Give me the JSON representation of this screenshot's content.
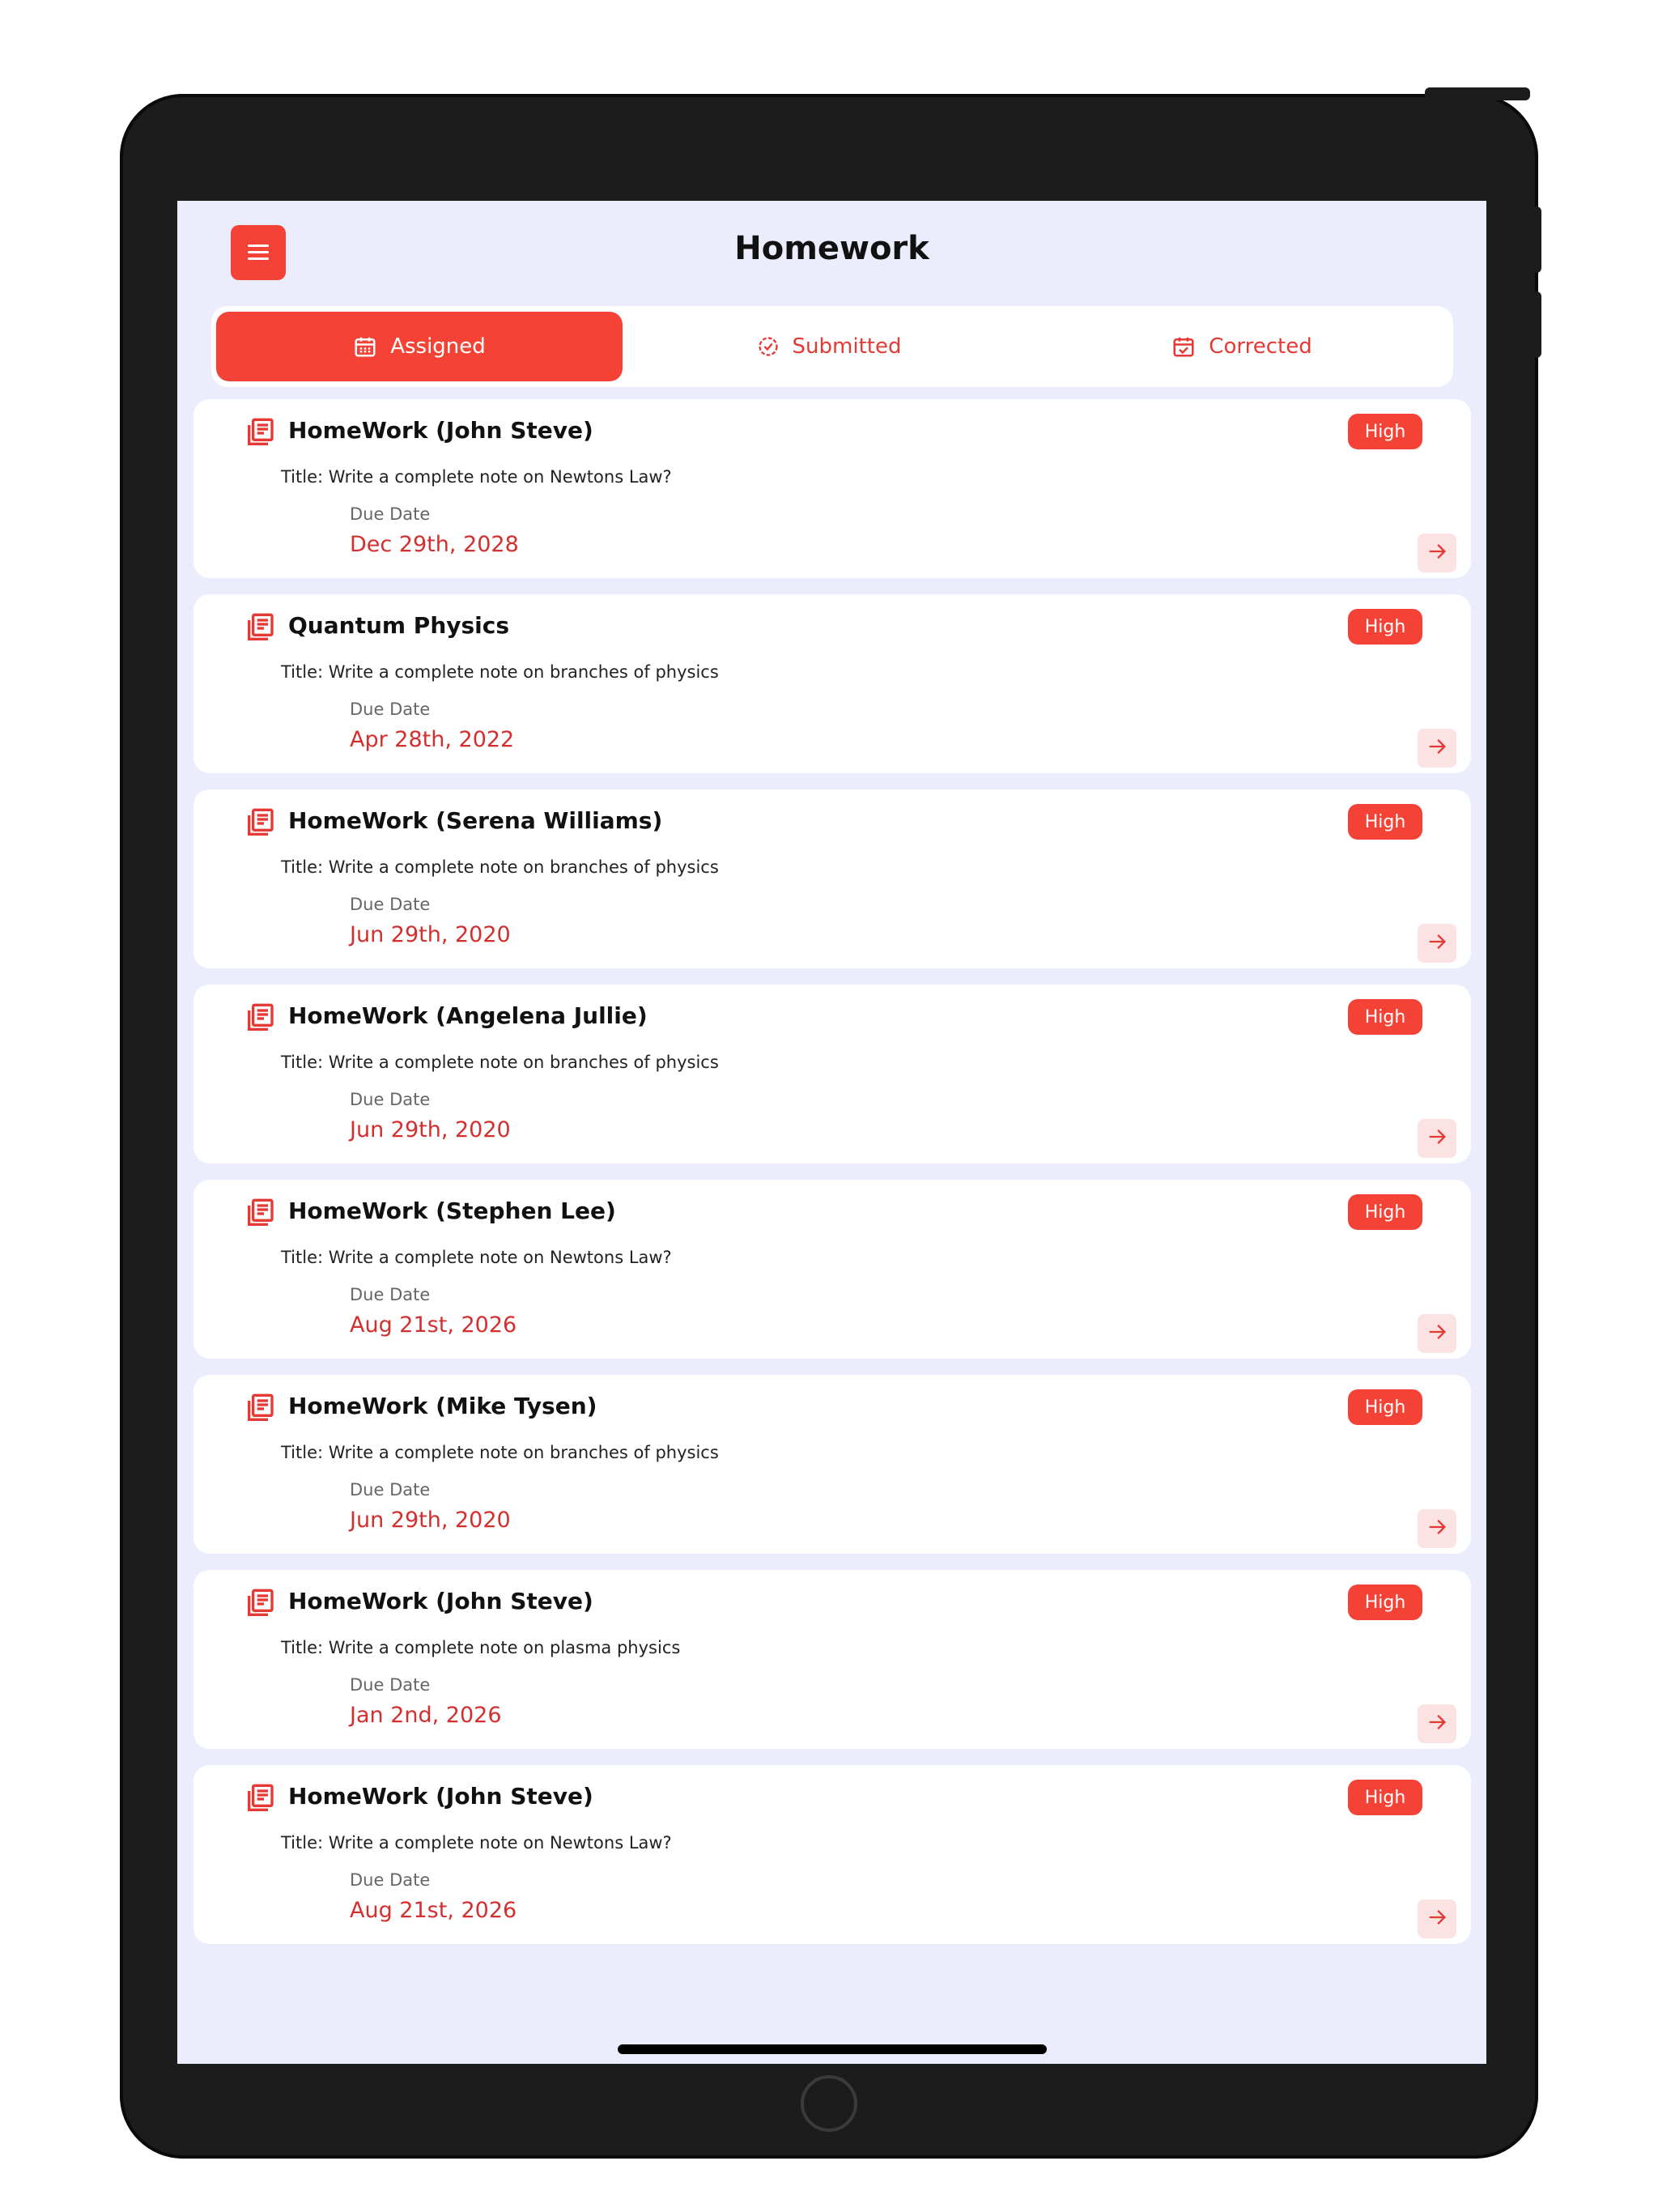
{
  "header": {
    "title": "Homework"
  },
  "tabs": [
    {
      "label": "Assigned",
      "icon": "calendar-icon",
      "active": true
    },
    {
      "label": "Submitted",
      "icon": "check-circle-icon",
      "active": false
    },
    {
      "label": "Corrected",
      "icon": "calendar-check-icon",
      "active": false
    }
  ],
  "colors": {
    "accent": "#f44336",
    "date": "#d32f2f",
    "background": "#ebedfd",
    "arrow_bg": "#fbe3e3"
  },
  "homework": {
    "due_label": "Due Date",
    "items": [
      {
        "name": "HomeWork (John Steve)",
        "priority": "High",
        "title": "Title: Write a complete note on Newtons Law?",
        "due_label": "Due Date",
        "due_date": "Dec 29th, 2028"
      },
      {
        "name": "Quantum Physics",
        "priority": "High",
        "title": "Title: Write a complete note on branches of physics",
        "due_label": "Due Date",
        "due_date": "Apr 28th, 2022"
      },
      {
        "name": "HomeWork (Serena Williams)",
        "priority": "High",
        "title": "Title: Write a complete note on branches of physics",
        "due_label": "Due Date",
        "due_date": "Jun 29th, 2020"
      },
      {
        "name": "HomeWork (Angelena Jullie)",
        "priority": "High",
        "title": "Title: Write a complete note on branches of physics",
        "due_label": "Due Date",
        "due_date": "Jun 29th, 2020"
      },
      {
        "name": "HomeWork (Stephen  Lee)",
        "priority": "High",
        "title": "Title: Write a complete note on Newtons Law?",
        "due_label": "Due Date",
        "due_date": "Aug 21st, 2026"
      },
      {
        "name": "HomeWork (Mike  Tysen)",
        "priority": "High",
        "title": "Title: Write a complete note on branches of physics",
        "due_label": "Due Date",
        "due_date": "Jun 29th, 2020"
      },
      {
        "name": "HomeWork (John Steve)",
        "priority": "High",
        "title": "Title: Write a complete note on plasma  physics",
        "due_label": "Due Date",
        "due_date": "Jan 2nd, 2026"
      },
      {
        "name": "HomeWork (John Steve)",
        "priority": "High",
        "title": "Title: Write a complete note on Newtons Law?",
        "due_label": "Due Date",
        "due_date": "Aug 21st, 2026"
      }
    ]
  }
}
